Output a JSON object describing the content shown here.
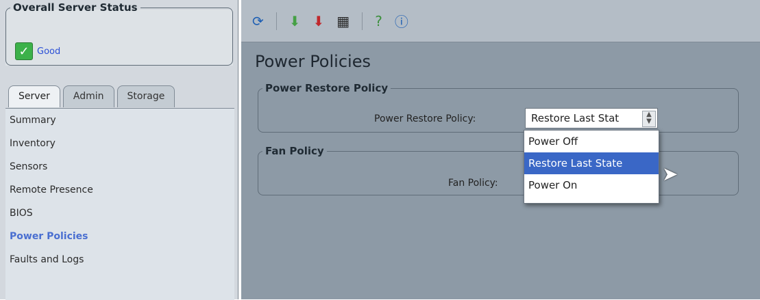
{
  "server_status": {
    "title": "Overall Server Status",
    "value": "Good"
  },
  "tabs": [
    {
      "label": "Server"
    },
    {
      "label": "Admin"
    },
    {
      "label": "Storage"
    }
  ],
  "nav": [
    {
      "label": "Summary"
    },
    {
      "label": "Inventory"
    },
    {
      "label": "Sensors"
    },
    {
      "label": "Remote Presence"
    },
    {
      "label": "BIOS"
    },
    {
      "label": "Power Policies"
    },
    {
      "label": "Faults and Logs"
    }
  ],
  "main": {
    "title": "Power Policies",
    "restore_group": "Power Restore Policy",
    "restore_label": "Power Restore Policy:",
    "restore_value": "Restore Last Stat",
    "fan_group": "Fan Policy",
    "fan_label": "Fan Policy:",
    "options": [
      {
        "label": "Power Off"
      },
      {
        "label": "Restore Last State"
      },
      {
        "label": "Power On"
      }
    ]
  },
  "toolbar_icons": [
    "refresh-icon",
    "download-green-icon",
    "download-red-icon",
    "keyboard-icon",
    "help-icon",
    "info-icon"
  ]
}
